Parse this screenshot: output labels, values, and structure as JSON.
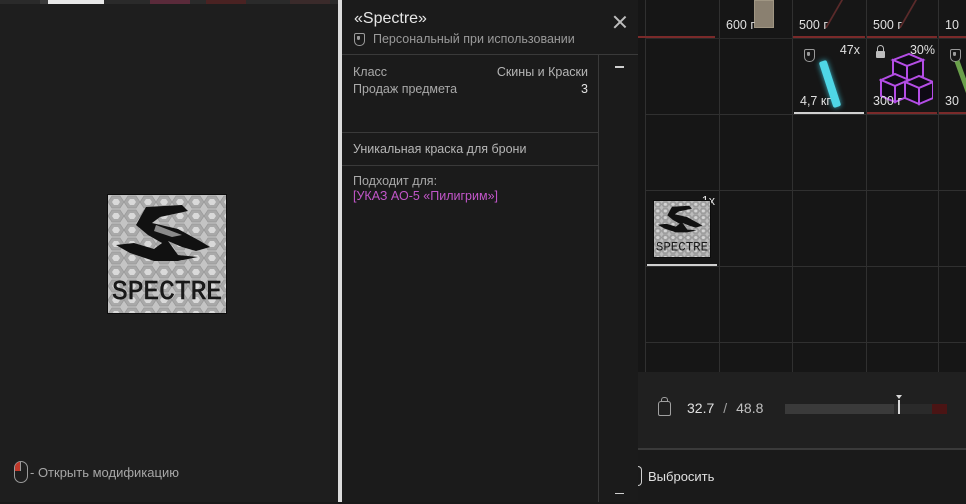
{
  "preview": {
    "hint_text": "- Открыть модификацию",
    "item_logo_text": "SPECTRE",
    "colors": {
      "accent_red": "#c0392b"
    }
  },
  "tooltip": {
    "title": "«Spectre»",
    "binding": "Персональный при использовании",
    "stats": [
      {
        "label": "Класс",
        "value": "Скины и Краски"
      },
      {
        "label": "Продаж предмета",
        "value": "3"
      }
    ],
    "description": "Уникальная краска для брони",
    "fits_label": "Подходит для:",
    "fits_item": "[УКАЗ АО-5 «Пилигрим»]",
    "colors": {
      "fits_item": "#c256c9",
      "border": "#dcdcdc"
    }
  },
  "inventory": {
    "top_row": [
      {
        "weight": "600 г",
        "icon": "paper-icon"
      },
      {
        "weight": "500 г",
        "icon": "item-icon"
      },
      {
        "weight": "500 г",
        "icon": "item-icon"
      },
      {
        "weight": "10",
        "icon": "item-icon"
      }
    ],
    "second_row": [
      {
        "weight": "4,7 кг",
        "count": "47x",
        "icon": "glowstick-icon",
        "locked": false
      },
      {
        "weight": "300 г",
        "count": "30%",
        "icon": "purple-cubes-icon",
        "locked": true
      },
      {
        "weight": "30",
        "count": "",
        "icon": "item-icon",
        "locked": false
      }
    ],
    "spectre_slot": {
      "count": "1x",
      "logo_text": "SPECTRE"
    },
    "weight": {
      "current": "32.7",
      "separator": "/",
      "max": "48.8",
      "fill_fraction": 0.67
    },
    "drop_button": "Выбросить",
    "colors": {
      "cap_red": "#7a2a2a",
      "cap_light": "#d0d0d0",
      "overweight": "#4a1414"
    }
  }
}
